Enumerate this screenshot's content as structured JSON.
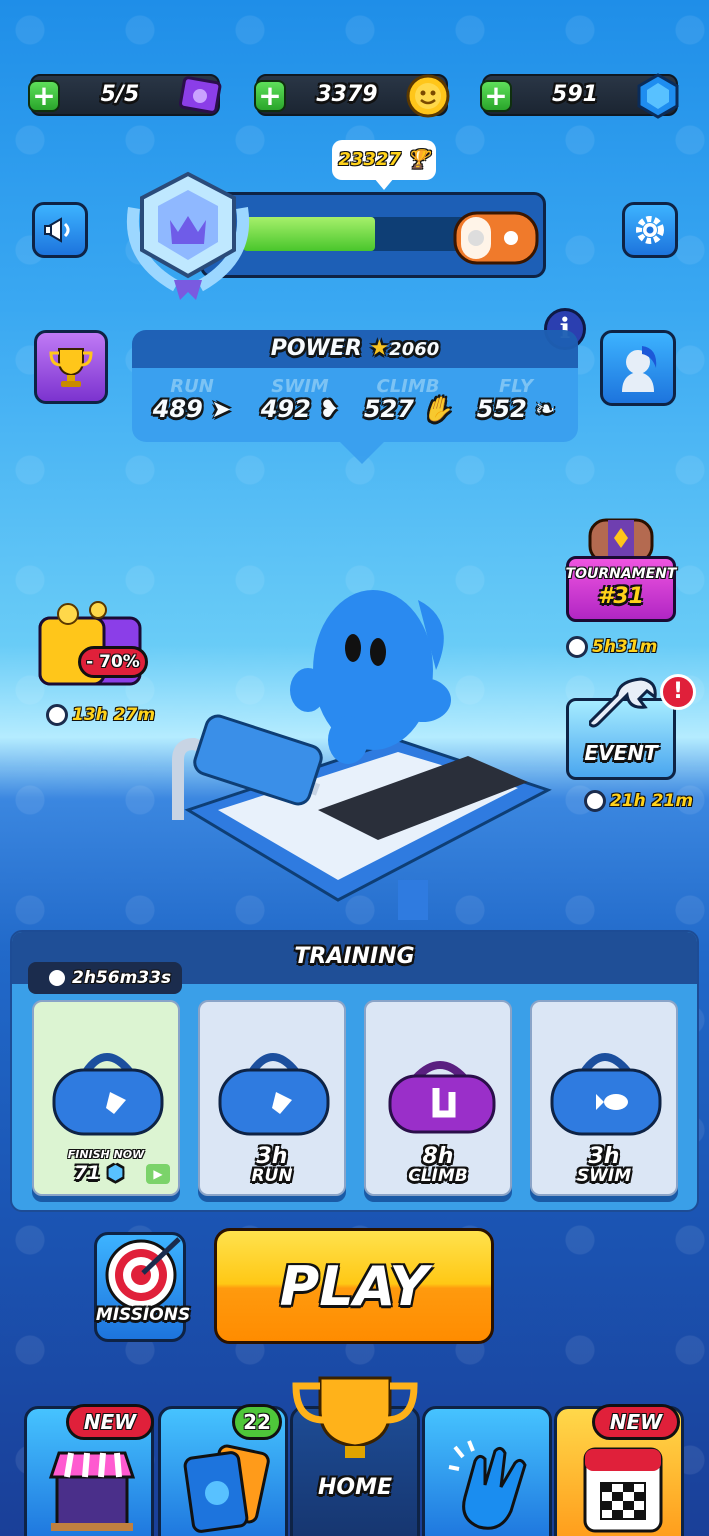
{
  "currencies": {
    "tickets": "5/5",
    "coins": "3379",
    "gems": "591"
  },
  "rank": {
    "trophies": "23327",
    "progress": 0.55
  },
  "power": {
    "title": "POWER",
    "value": "2060",
    "stats": [
      {
        "label": "RUN",
        "value": "489"
      },
      {
        "label": "SWIM",
        "value": "492"
      },
      {
        "label": "CLIMB",
        "value": "527"
      },
      {
        "label": "FLY",
        "value": "552"
      }
    ]
  },
  "offer": {
    "discount": "- 70%",
    "timer": "13h 27m"
  },
  "tournament": {
    "label": "TOURNAMENT",
    "number": "#31",
    "timer": "5h31m"
  },
  "event": {
    "label": "EVENT",
    "alert": "!",
    "timer": "21h 21m"
  },
  "training": {
    "title": "TRAINING",
    "timer": "2h56m33s",
    "cards": [
      {
        "line1": "FINISH NOW",
        "line2": "71",
        "kind": "run",
        "bag_color": "#2f7be0",
        "active": true
      },
      {
        "line1": "3h",
        "line2": "RUN",
        "kind": "run",
        "bag_color": "#2f7be0"
      },
      {
        "line1": "8h",
        "line2": "CLIMB",
        "kind": "climb",
        "bag_color": "#9a2fc9"
      },
      {
        "line1": "3h",
        "line2": "SWIM",
        "kind": "swim",
        "bag_color": "#2f7be0"
      }
    ]
  },
  "missions": {
    "label": "MISSIONS"
  },
  "play": {
    "label": "PLAY"
  },
  "tabs": {
    "shop_tag": "NEW",
    "cards_tag": "22",
    "home_label": "HOME",
    "calendar_tag": "NEW"
  },
  "colors": {
    "accent": "#ffc815",
    "brand": "#2169c9",
    "coin": "#ffc61a",
    "gem": "#1e8df0"
  }
}
